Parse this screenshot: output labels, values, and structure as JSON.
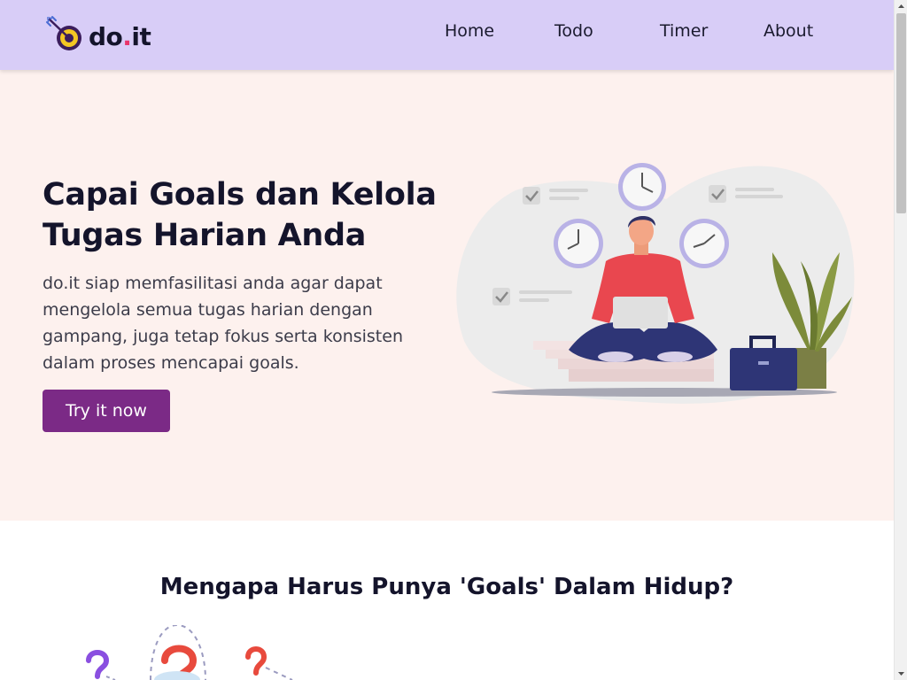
{
  "brand": {
    "name_main": "do",
    "name_dot": ".",
    "name_suffix": "it",
    "accent_color": "#e8356b",
    "icon": "target-arrow-icon"
  },
  "nav": {
    "items": [
      {
        "label": "Home"
      },
      {
        "label": "Todo"
      },
      {
        "label": "Timer"
      },
      {
        "label": "About"
      }
    ]
  },
  "hero": {
    "title": "Capai Goals dan Kelola Tugas Harian Anda",
    "description": "do.it siap memfasilitasi anda agar dapat mengelola semua tugas harian dengan gampang, juga tetap fokus serta konsisten dalam proses mencapai goals.",
    "cta_label": "Try it now",
    "cta_color": "#7b2a86",
    "background": "#fdf1ee"
  },
  "section2": {
    "title": "Mengapa Harus Punya 'Goals' Dalam Hidup?"
  },
  "colors": {
    "header_bg": "#d8cdf7",
    "text_dark": "#14142b"
  }
}
